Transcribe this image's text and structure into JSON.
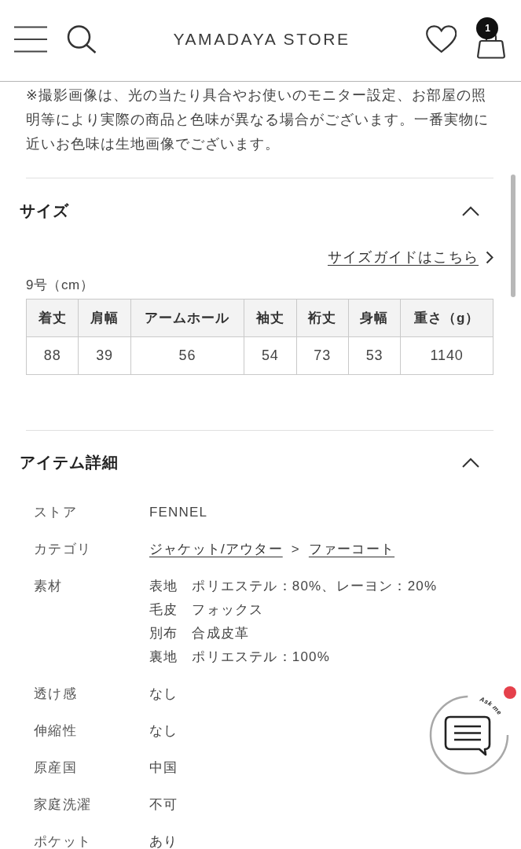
{
  "header": {
    "title": "YAMADAYA STORE",
    "cart_count": "1"
  },
  "note": "※撮影画像は、光の当たり具合やお使いのモニター設定、お部屋の照明等により実際の商品と色味が異なる場合がございます。一番実物に近いお色味は生地画像でございます。",
  "sections": [
    {
      "kind": "size",
      "title": "サイズ",
      "expanded": true,
      "guide_link": "サイズガイドはこちら",
      "table_caption": "9号（cm）",
      "table": {
        "columns": [
          "着丈",
          "肩幅",
          "アームホール",
          "袖丈",
          "裄丈",
          "身幅",
          "重さ（g）"
        ],
        "rows": [
          [
            "88",
            "39",
            "56",
            "54",
            "73",
            "53",
            "1140"
          ]
        ]
      }
    },
    {
      "kind": "details",
      "title": "アイテム詳細",
      "expanded": true,
      "rows": [
        {
          "kind": "text",
          "label": "ストア",
          "value": "FENNEL"
        },
        {
          "kind": "links",
          "label": "カテゴリ",
          "links": [
            "ジャケット/アウター",
            "ファーコート"
          ],
          "separator": ">"
        },
        {
          "kind": "materials",
          "label": "素材",
          "lines": [
            {
              "part": "表地",
              "material": "ポリエステル：80%、レーヨン：20%"
            },
            {
              "part": "毛皮",
              "material": "フォックス"
            },
            {
              "part": "別布",
              "material": "合成皮革"
            },
            {
              "part": "裏地",
              "material": "ポリエステル：100%"
            }
          ]
        },
        {
          "kind": "text",
          "label": "透け感",
          "value": "なし"
        },
        {
          "kind": "text",
          "label": "伸縮性",
          "value": "なし"
        },
        {
          "kind": "text",
          "label": "原産国",
          "value": "中国"
        },
        {
          "kind": "text",
          "label": "家庭洗濯",
          "value": "不可"
        },
        {
          "kind": "text",
          "label": "ポケット",
          "value": "あり"
        }
      ]
    }
  ],
  "chat_widget": {
    "label": "Ask me",
    "unread": true
  }
}
